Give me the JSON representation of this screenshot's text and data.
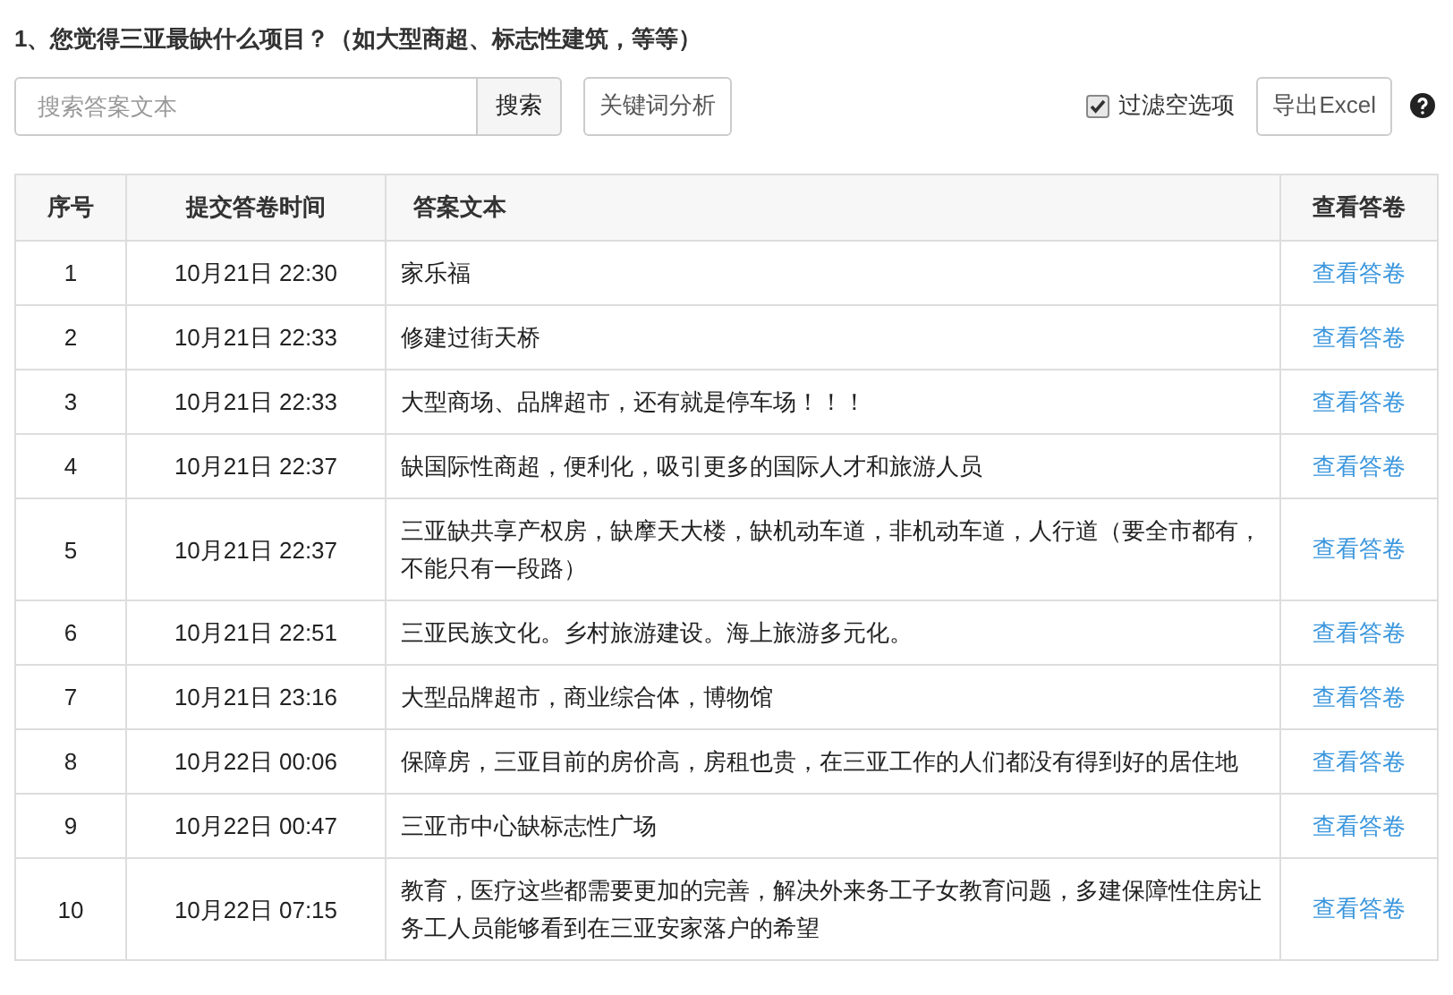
{
  "question": "1、您觉得三亚最缺什么项目？（如大型商超、标志性建筑，等等）",
  "search": {
    "placeholder": "搜索答案文本",
    "button": "搜索"
  },
  "keyword_button": "关键词分析",
  "filter": {
    "label": "过滤空选项",
    "checked": true
  },
  "export_button": "导出Excel",
  "table": {
    "columns": [
      "序号",
      "提交答卷时间",
      "答案文本",
      "查看答卷"
    ],
    "rows": [
      {
        "no": "1",
        "time": "10月21日 22:30",
        "answer": "家乐福",
        "link": "查看答卷"
      },
      {
        "no": "2",
        "time": "10月21日 22:33",
        "answer": "修建过街天桥",
        "link": "查看答卷"
      },
      {
        "no": "3",
        "time": "10月21日 22:33",
        "answer": "大型商场、品牌超市，还有就是停车场！！！",
        "link": "查看答卷"
      },
      {
        "no": "4",
        "time": "10月21日 22:37",
        "answer": "缺国际性商超，便利化，吸引更多的国际人才和旅游人员",
        "link": "查看答卷"
      },
      {
        "no": "5",
        "time": "10月21日 22:37",
        "answer": "三亚缺共享产权房，缺摩天大楼，缺机动车道，非机动车道，人行道（要全市都有，不能只有一段路）",
        "link": "查看答卷"
      },
      {
        "no": "6",
        "time": "10月21日 22:51",
        "answer": "三亚民族文化。乡村旅游建设。海上旅游多元化。",
        "link": "查看答卷"
      },
      {
        "no": "7",
        "time": "10月21日 23:16",
        "answer": "大型品牌超市，商业综合体，博物馆",
        "link": "查看答卷"
      },
      {
        "no": "8",
        "time": "10月22日 00:06",
        "answer": "保障房，三亚目前的房价高，房租也贵，在三亚工作的人们都没有得到好的居住地",
        "link": "查看答卷"
      },
      {
        "no": "9",
        "time": "10月22日 00:47",
        "answer": "三亚市中心缺标志性广场",
        "link": "查看答卷"
      },
      {
        "no": "10",
        "time": "10月22日 07:15",
        "answer": "教育，医疗这些都需要更加的完善，解决外来务工子女教育问题，多建保障性住房让务工人员能够看到在三亚安家落户的希望",
        "link": "查看答卷"
      }
    ]
  }
}
